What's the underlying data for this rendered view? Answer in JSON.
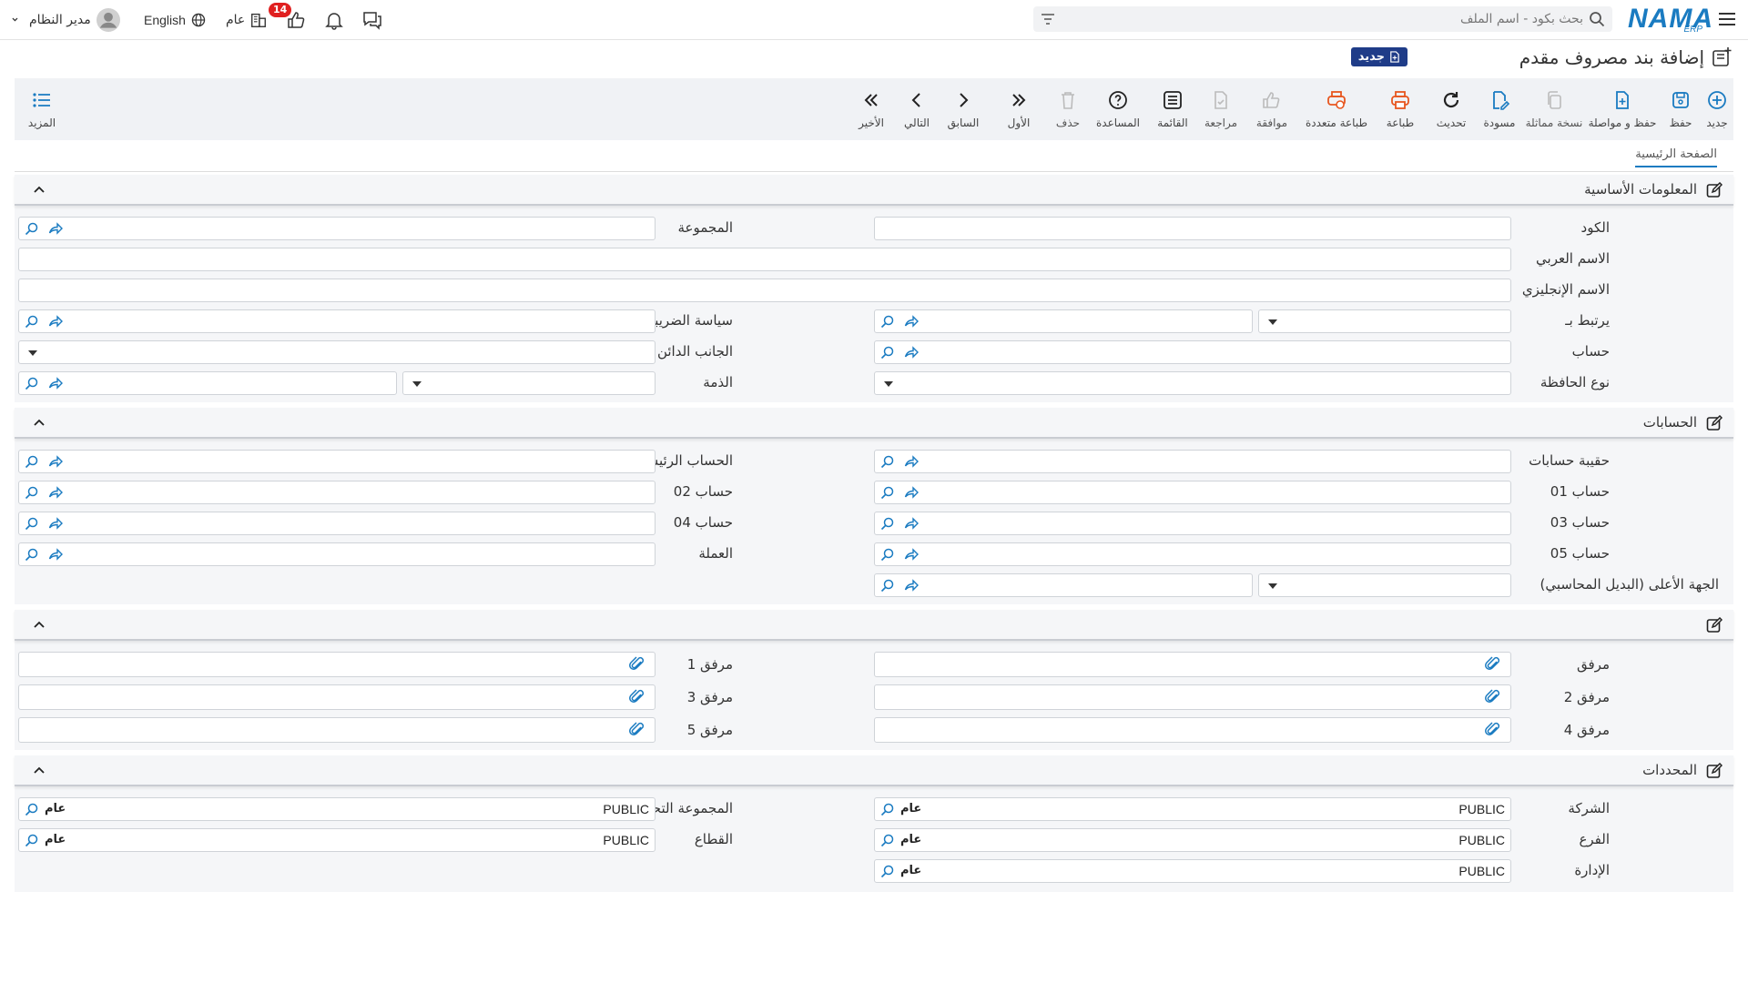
{
  "topbar": {
    "logo_text": "NAMA",
    "logo_sub": "ERP",
    "search_placeholder": "بحث بكود - اسم الملف",
    "user_name": "مدير النظام",
    "language": "English",
    "scope": "عام",
    "notification_count": "14"
  },
  "page": {
    "title": "إضافة بند مصروف مقدم",
    "new_badge": "جديد"
  },
  "toolbar": {
    "new": "جديد",
    "save": "حفظ",
    "save_continue": "حفظ و مواصلة",
    "copy": "نسخة مماثلة",
    "draft": "مسودة",
    "refresh": "تحديث",
    "print": "طباعة",
    "multi_print": "طباعة متعددة",
    "approve": "موافقة",
    "review": "مراجعة",
    "list": "القائمة",
    "help": "المساعدة",
    "delete": "حذف",
    "first": "الأول",
    "prev": "السابق",
    "next": "التالي",
    "last": "الأخير",
    "more": "المزيد"
  },
  "tabs": {
    "main": "الصفحة الرئيسية"
  },
  "sections": {
    "basic": "المعلومات الأساسية",
    "accounts": "الحسابات",
    "attachments": "",
    "dimensions": "المحددات"
  },
  "basic": {
    "code": "الكود",
    "group": "المجموعة",
    "arabic_name": "الاسم العربي",
    "english_name": "الاسم الإنجليزي",
    "linked_to": "يرتبط بـ",
    "tax_policy": "سياسة الضريبة",
    "account": "حساب",
    "credit_side": "الجانب الدائن",
    "portfolio_type": "نوع الحافظة",
    "liability": "الذمة"
  },
  "accounts": {
    "account_bag": "حقيبة حسابات",
    "main_account": "الحساب الرئيسي",
    "account01": "حساب 01",
    "account02": "حساب 02",
    "account03": "حساب 03",
    "account04": "حساب 04",
    "account05": "حساب 05",
    "currency": "العملة",
    "higher_entity": "الجهة الأعلى (البديل المحاسبي)"
  },
  "attachments": {
    "a0": "مرفق",
    "a1": "مرفق 1",
    "a2": "مرفق 2",
    "a3": "مرفق 3",
    "a4": "مرفق 4",
    "a5": "مرفق 5"
  },
  "dimensions": {
    "company": "الشركة",
    "analytic_group": "المجموعة التحليلية",
    "branch": "الفرع",
    "sector": "القطاع",
    "department": "الإدارة",
    "value": "PUBLIC",
    "tag": "عام"
  },
  "colors": {
    "accent": "#1a7bc1",
    "print": "#e8561f",
    "badge": "#e02020",
    "new_badge": "#1f3c88"
  }
}
